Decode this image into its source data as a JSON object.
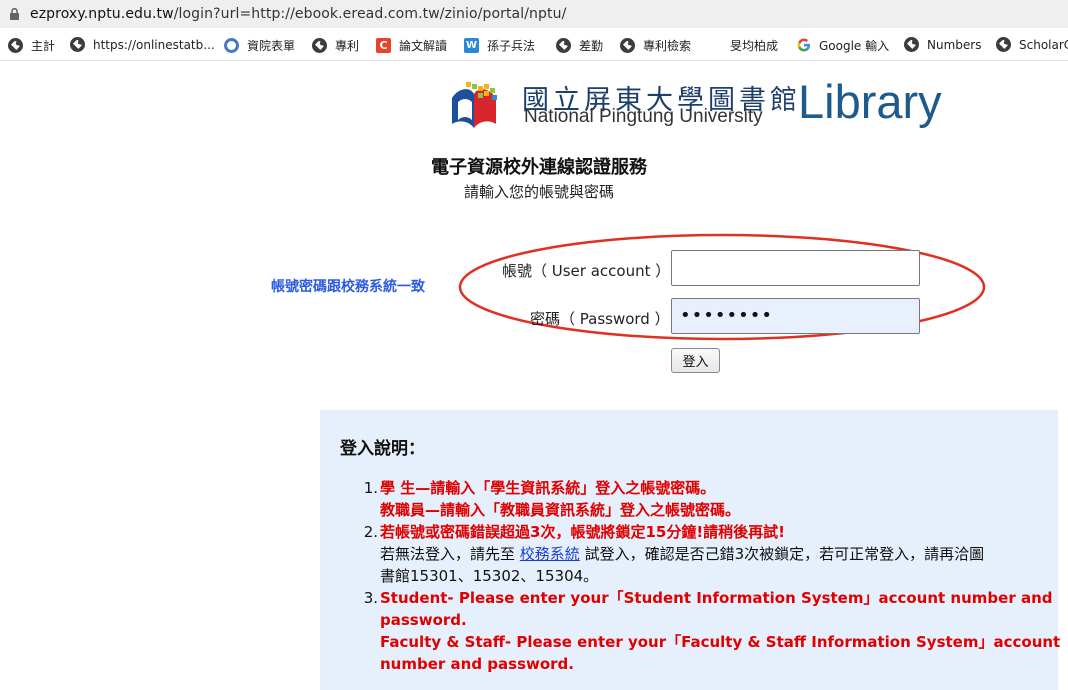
{
  "browser": {
    "url_host": "ezproxy.nptu.edu.tw",
    "url_path": "/login?url=http://ebook.eread.com.tw/zinio/portal/nptu/"
  },
  "bookmarks": [
    {
      "label": "主計",
      "icon": "globe-icon"
    },
    {
      "label": "https://onlinestatb...",
      "icon": "globe-icon"
    },
    {
      "label": "資院表單",
      "icon": "ring-icon"
    },
    {
      "label": "專利",
      "icon": "globe-icon"
    },
    {
      "label": "論文解讀",
      "icon": "c-icon"
    },
    {
      "label": "孫子兵法",
      "icon": "w-icon"
    },
    {
      "label": "差勤",
      "icon": "globe-icon"
    },
    {
      "label": "專利檢索",
      "icon": "globe-icon"
    },
    {
      "label": "旻均柏成",
      "icon": ""
    },
    {
      "label": "Google 輸入",
      "icon": "google-icon"
    },
    {
      "label": "Numbers",
      "icon": "globe-icon"
    },
    {
      "label": "ScholarC",
      "icon": "globe-icon"
    }
  ],
  "logo": {
    "chinese": "國立屏東大學圖書館",
    "english": "National Pingtung University",
    "library": "Library"
  },
  "page": {
    "title": "電子資源校外連線認證服務",
    "subtitle": "請輸入您的帳號與密碼",
    "note": "帳號密碼跟校務系統一致"
  },
  "form": {
    "account_label": "帳號（ User account ）",
    "account_value": "",
    "password_label": "密碼（ Password ）",
    "password_value": "••••••••",
    "login_button": "登入"
  },
  "instructions": {
    "title": "登入說明：",
    "item1_line1": "學 生—請輸入「學生資訊系統」登入之帳號密碼。",
    "item1_line2": "教職員—請輸入「教職員資訊系統」登入之帳號密碼。",
    "item2_line1": "若帳號或密碼錯誤超過3次，帳號將鎖定15分鐘!請稍後再試!",
    "item2_line2_a": "若無法登入，請先至",
    "item2_link": "校務系統",
    "item2_line2_b": "試登入，確認是否己錯3次被鎖定，若可正常登入，請再洽圖",
    "item2_line3": "書館15301、15302、15304。",
    "item3_line1": "Student- Please enter your「Student Information System」account number and",
    "item3_line2": "password.",
    "item3_line3": "Faculty & Staff- Please enter your「Faculty & Staff Information System」account",
    "item3_line4": "number and password.",
    "numbers": [
      "1.",
      "2.",
      "3."
    ]
  },
  "colors": {
    "warning": "#e00000",
    "note": "#2d5ce0",
    "panel": "#e6f0fc",
    "ellipse": "#e03020"
  }
}
